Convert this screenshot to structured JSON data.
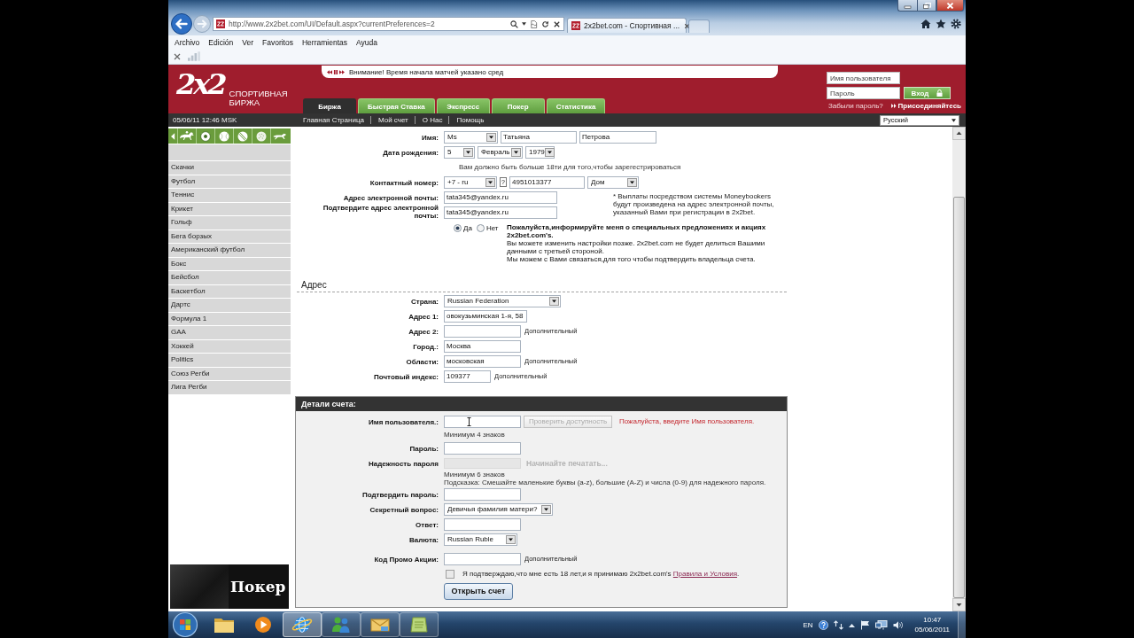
{
  "browser": {
    "address": "http://www.2x2bet.com/UI/Default.aspx?currentPreferences=2",
    "tab_title": "2x2bet.com - Спортивная ...",
    "menu": [
      "Archivo",
      "Edición",
      "Ver",
      "Favoritos",
      "Herramientas",
      "Ayuda"
    ]
  },
  "header": {
    "logo": "2x2",
    "brand": [
      "СПОРТИВНАЯ",
      "БИРЖА"
    ],
    "ticker": "Внимание! Время начала матчей указано сред",
    "tabs": [
      {
        "label": "Биржа",
        "selected": true
      },
      {
        "label": "Быстрая Ставка",
        "selected": false
      },
      {
        "label": "Экспресс",
        "selected": false
      },
      {
        "label": "Покер",
        "selected": false
      },
      {
        "label": "Статистика",
        "selected": false
      }
    ],
    "login": {
      "username_placeholder": "Имя пользователя",
      "password_placeholder": "Пароль",
      "button": "Вход",
      "forgot": "Забыли пароль?",
      "join": "Присоединяйтесь"
    }
  },
  "nav": {
    "datetime": "05/06/11 12:46 MSK",
    "links": [
      "Главная Страница",
      "Мой счет",
      "О Нас",
      "Помощь"
    ],
    "language": "Русский"
  },
  "sidebar": {
    "sports": [
      "Скачки",
      "Футбол",
      "Теннис",
      "Крикет",
      "Гольф",
      "Бега борзых",
      "Американский футбол",
      "Бокс",
      "Бейсбол",
      "Баскетбол",
      "Дартс",
      "Формула 1",
      "GAA",
      "Хоккей",
      "Politics",
      "Союз Регби",
      "Лига Регби"
    ],
    "banner": "Покер"
  },
  "personal": {
    "rows": [
      {
        "label": "Имя:",
        "fields": [
          {
            "kind": "select",
            "value": "Ms"
          },
          {
            "kind": "input",
            "value": "Татьяна"
          },
          {
            "kind": "input",
            "value": "Петрова"
          }
        ]
      },
      {
        "label": "Дата рождения:",
        "fields": [
          {
            "kind": "select",
            "value": "5"
          },
          {
            "kind": "select",
            "value": "Февраль"
          },
          {
            "kind": "select",
            "value": "1979"
          }
        ]
      },
      {
        "fields": [
          {
            "kind": "hint",
            "value": "Вам должно быть больше 18ти для того,чтобы зарегестрироваться"
          }
        ]
      },
      {
        "label": "Контактный номер:",
        "fields": [
          {
            "kind": "select",
            "value": "+7 - ru"
          },
          {
            "kind": "help",
            "value": "?"
          },
          {
            "kind": "input",
            "value": "4951013377"
          },
          {
            "kind": "select",
            "value": "Дом"
          }
        ]
      },
      {
        "label": "Адрес электронной почты:",
        "fields": [
          {
            "kind": "input",
            "value": "tata345@yandex.ru"
          }
        ],
        "aside": "* Выплаты посредством системы Moneybookers будут произведена на адрес электронной почты, указанный Вами при регистрации в 2x2bet."
      },
      {
        "label": "Подтвердите адрес электронной почты:",
        "fields": [
          {
            "kind": "input",
            "value": "tata345@yandex.ru"
          }
        ]
      }
    ],
    "marketing": {
      "options": [
        {
          "label": "Да",
          "selected": true
        },
        {
          "label": "Нет",
          "selected": false
        }
      ],
      "title": "Пожалуйста,информируйте меня о специальных предложениях и акциях 2x2bet.com's.",
      "notes": [
        "Вы можете изменить настройки позже. 2x2bet.com не будет делиться Вашими данными с третьей стороной.",
        "Мы можем с Вами связаться,для того чтобы подтвердить владельца счета."
      ]
    }
  },
  "address": {
    "title": "Адрес",
    "rows": [
      {
        "label": "Страна:",
        "fields": [
          {
            "kind": "select",
            "value": "Russian Federation"
          }
        ]
      },
      {
        "label": "Адрес 1:",
        "fields": [
          {
            "kind": "input",
            "value": "овокузьминская 1-я, 58"
          }
        ]
      },
      {
        "label": "Адрес 2:",
        "fields": [
          {
            "kind": "input"
          },
          {
            "kind": "note",
            "value": "Дополнительный"
          }
        ]
      },
      {
        "label": "Город.:",
        "fields": [
          {
            "kind": "input",
            "value": "Москва"
          }
        ]
      },
      {
        "label": "Области:",
        "fields": [
          {
            "kind": "input",
            "value": "московская"
          },
          {
            "kind": "note",
            "value": "Дополнительный"
          }
        ]
      },
      {
        "label": "Почтовый индекс:",
        "fields": [
          {
            "kind": "input",
            "value": "109377"
          },
          {
            "kind": "note",
            "value": "Дополнительный"
          }
        ]
      }
    ]
  },
  "account": {
    "title": "Детали счета:",
    "rows": [
      {
        "label": "Имя пользователя.:",
        "fields": [
          {
            "kind": "input",
            "hovered": true
          },
          {
            "kind": "button",
            "value": "Проверить доступность",
            "disabled": true
          },
          {
            "kind": "error",
            "value": "Пожалуйста, введите Имя пользователя."
          }
        ]
      },
      {
        "fields": [
          {
            "kind": "hint",
            "value": "Минимум 4 знаков"
          }
        ]
      },
      {
        "label": "Пароль:",
        "fields": [
          {
            "kind": "input"
          }
        ]
      },
      {
        "label": "Надежность пароля",
        "fields": [
          {
            "kind": "meter"
          },
          {
            "kind": "status",
            "value": "Начинайте печатать..."
          }
        ]
      },
      {
        "fields": [
          {
            "kind": "hint",
            "value": "Минимум 6 знаков"
          },
          {
            "kind": "hint",
            "value": "Подсказка: Смешайте маленькие буквы (a-z), большие (A-Z) и числа (0-9) для надежного пароля."
          }
        ]
      },
      {
        "label": "Подтвердить пароль:",
        "fields": [
          {
            "kind": "input"
          }
        ]
      },
      {
        "label": "Секретный вопрос:",
        "fields": [
          {
            "kind": "select",
            "value": "Девичья фамилия матери?"
          }
        ]
      },
      {
        "label": "Ответ:",
        "fields": [
          {
            "kind": "input"
          }
        ]
      },
      {
        "label": "Валюта:",
        "fields": [
          {
            "kind": "select",
            "value": "Russian Ruble"
          }
        ]
      },
      {
        "label": "Код Промо Акции:",
        "fields": [
          {
            "kind": "input"
          },
          {
            "kind": "note",
            "value": "Дополнительный"
          }
        ]
      }
    ],
    "consent": {
      "checked": false,
      "text": "Я подтверждаю,что мне есть 18 лет,и я принимаю 2x2bet.com's",
      "link": "Правила и Условия",
      "suffix": "."
    },
    "submit": "Открыть счет"
  },
  "taskbar": {
    "apps": [
      {
        "kind": "folder",
        "running": false,
        "selected": false
      },
      {
        "kind": "media",
        "running": false,
        "selected": false
      },
      {
        "kind": "browser",
        "running": true,
        "selected": true
      },
      {
        "kind": "messenger",
        "running": true,
        "selected": false
      },
      {
        "kind": "mail",
        "running": true,
        "selected": false
      },
      {
        "kind": "notes",
        "running": true,
        "selected": false
      }
    ],
    "language": "EN",
    "time": "10:47",
    "date": "05/06/2011"
  }
}
